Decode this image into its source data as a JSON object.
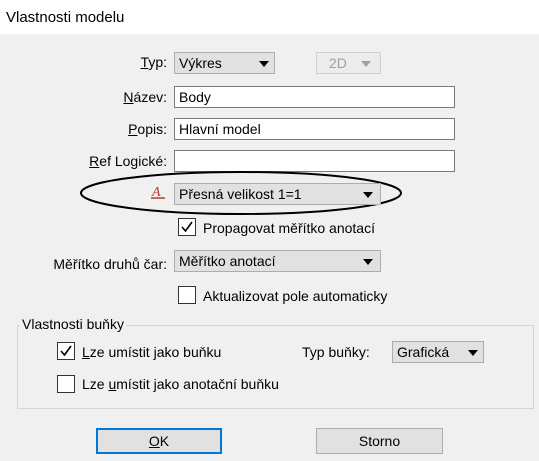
{
  "window": {
    "title": "Vlastnosti modelu"
  },
  "type": {
    "label_u": "T",
    "label_rest": "yp:",
    "value": "Výkres",
    "dimension": "2D"
  },
  "name": {
    "label_u": "N",
    "label_rest": "ázev:",
    "value": "Body"
  },
  "description": {
    "label_u": "P",
    "label_rest": "opis:",
    "value": "Hlavní model"
  },
  "ref_logical": {
    "label_u": "R",
    "label_rest": "ef Logické:",
    "value": ""
  },
  "annotation_scale": {
    "value": "Přesná velikost 1=1",
    "icon": "annotation-scale-icon"
  },
  "propagate": {
    "label": "Propagovat měřítko anotací",
    "checked": true
  },
  "line_style_scale": {
    "label": "Měřítko druhů čar:",
    "value": "Měřítko anotací"
  },
  "auto_update": {
    "label": "Aktualizovat pole automaticky",
    "checked": false
  },
  "cell_properties": {
    "legend": "Vlastnosti buňky",
    "place_as_cell": {
      "label_u": "L",
      "label_rest": "ze umístit jako buňku",
      "checked": true
    },
    "cell_type": {
      "label": "Typ buňky:",
      "value": "Grafická"
    },
    "place_as_annotation_cell": {
      "label_pre": "Lze ",
      "label_u": "u",
      "label_rest": "místit jako anotační buňku",
      "checked": false
    }
  },
  "buttons": {
    "ok_u": "O",
    "ok_rest": "K",
    "cancel": "Storno"
  },
  "colors": {
    "accent": "#0078d7",
    "dialog_bg": "#f0f0f0",
    "annotation_icon": "#c0392b"
  }
}
